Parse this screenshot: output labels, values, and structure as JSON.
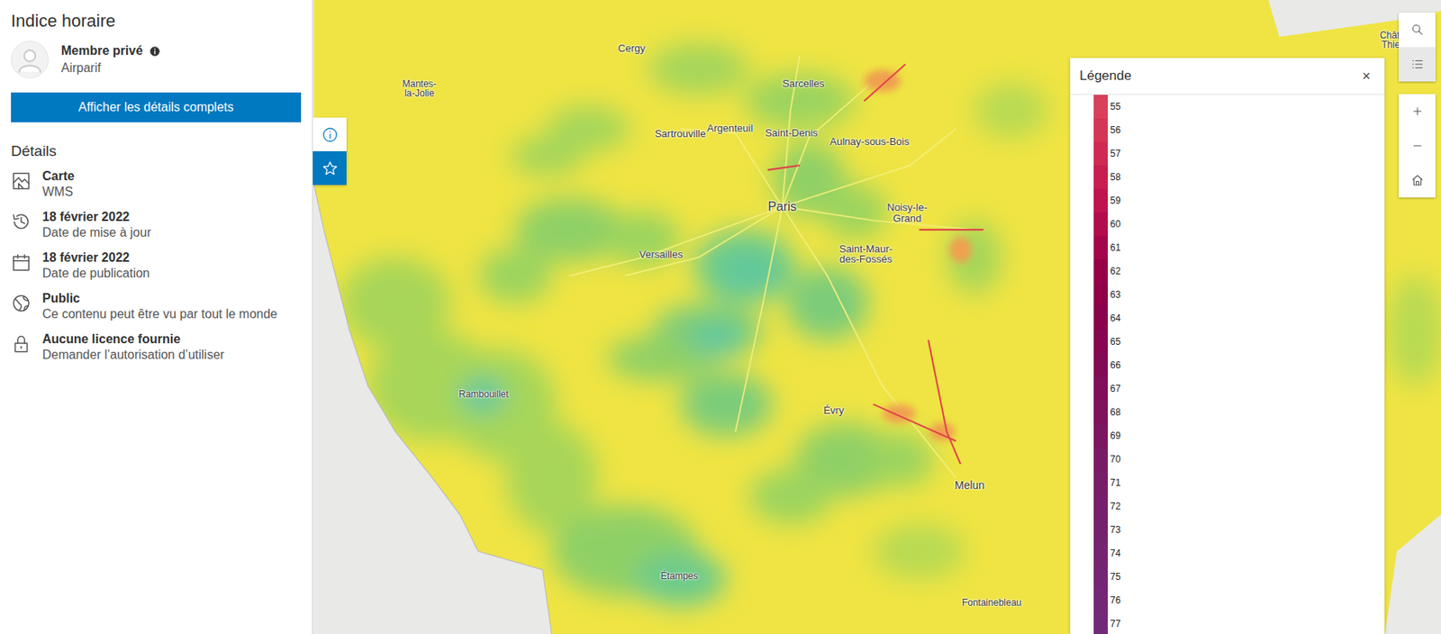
{
  "panel": {
    "title": "Indice horaire",
    "owner": "Membre privé",
    "org": "Airparif",
    "button": "Afficher les détails complets",
    "section": "Détails",
    "details": [
      {
        "title": "Carte",
        "subtitle": "WMS",
        "kind": "map"
      },
      {
        "title": "18 février 2022",
        "subtitle": "Date de mise à jour",
        "kind": "history"
      },
      {
        "title": "18 février 2022",
        "subtitle": "Date de publication",
        "kind": "calendar"
      },
      {
        "title": "Public",
        "subtitle": "Ce contenu peut être vu par tout le monde",
        "kind": "globe"
      },
      {
        "title": "Aucune licence fournie",
        "subtitle": "Demander l’autorisation d’utiliser",
        "kind": "lock"
      }
    ]
  },
  "side_tabs": [
    {
      "kind": "info",
      "selected": true
    },
    {
      "kind": "star",
      "selected": false
    }
  ],
  "map": {
    "labels": [
      "Cergy",
      "Mantes-la-Jolie",
      "Sarcelles",
      "Sartrouville",
      "Argenteuil",
      "Saint-Denis",
      "Aulnay-sous-Bois",
      "Paris",
      "Noisy-le-Grand",
      "Versailles",
      "Saint-Maur-des-Fossés",
      "Rambouillet",
      "Évry",
      "Melun",
      "Étampes",
      "Fontainebleau",
      "Châte Thier"
    ]
  },
  "legend": {
    "title": "Légende",
    "close": "×",
    "items": [
      {
        "value": "55",
        "color": "#d9405a"
      },
      {
        "value": "56",
        "color": "#d43656"
      },
      {
        "value": "57",
        "color": "#cf2a52"
      },
      {
        "value": "58",
        "color": "#c81e50"
      },
      {
        "value": "59",
        "color": "#bf144e"
      },
      {
        "value": "60",
        "color": "#b20c4c"
      },
      {
        "value": "61",
        "color": "#a3064a"
      },
      {
        "value": "62",
        "color": "#970048"
      },
      {
        "value": "63",
        "color": "#8f0048"
      },
      {
        "value": "64",
        "color": "#8a024b"
      },
      {
        "value": "65",
        "color": "#86064f"
      },
      {
        "value": "66",
        "color": "#820a54"
      },
      {
        "value": "67",
        "color": "#800e58"
      },
      {
        "value": "68",
        "color": "#7e125c"
      },
      {
        "value": "69",
        "color": "#7c1660"
      },
      {
        "value": "70",
        "color": "#7a1a64"
      },
      {
        "value": "71",
        "color": "#781d67"
      },
      {
        "value": "72",
        "color": "#761f6a"
      },
      {
        "value": "73",
        "color": "#75226d"
      },
      {
        "value": "74",
        "color": "#742470"
      },
      {
        "value": "75",
        "color": "#732673"
      },
      {
        "value": "76",
        "color": "#722876"
      },
      {
        "value": "77",
        "color": "#712a79"
      }
    ]
  },
  "toolbar": [
    {
      "kind": "search",
      "selected": false
    },
    {
      "kind": "legend",
      "selected": true
    },
    {
      "kind": "zoom-in",
      "selected": false
    },
    {
      "kind": "zoom-out",
      "selected": false
    },
    {
      "kind": "home",
      "selected": false
    }
  ]
}
